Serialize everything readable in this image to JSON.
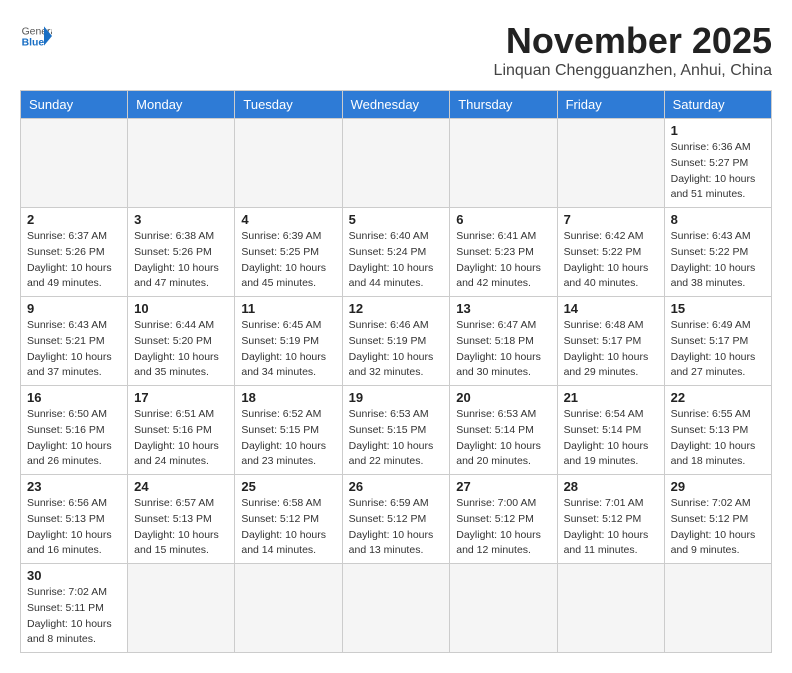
{
  "header": {
    "logo_general": "General",
    "logo_blue": "Blue",
    "month_title": "November 2025",
    "location": "Linquan Chengguanzhen, Anhui, China"
  },
  "weekdays": [
    "Sunday",
    "Monday",
    "Tuesday",
    "Wednesday",
    "Thursday",
    "Friday",
    "Saturday"
  ],
  "weeks": [
    [
      {
        "day": "",
        "empty": true
      },
      {
        "day": "",
        "empty": true
      },
      {
        "day": "",
        "empty": true
      },
      {
        "day": "",
        "empty": true
      },
      {
        "day": "",
        "empty": true
      },
      {
        "day": "",
        "empty": true
      },
      {
        "day": "1",
        "sunrise": "Sunrise: 6:36 AM",
        "sunset": "Sunset: 5:27 PM",
        "daylight": "Daylight: 10 hours and 51 minutes."
      }
    ],
    [
      {
        "day": "2",
        "sunrise": "Sunrise: 6:37 AM",
        "sunset": "Sunset: 5:26 PM",
        "daylight": "Daylight: 10 hours and 49 minutes."
      },
      {
        "day": "3",
        "sunrise": "Sunrise: 6:38 AM",
        "sunset": "Sunset: 5:26 PM",
        "daylight": "Daylight: 10 hours and 47 minutes."
      },
      {
        "day": "4",
        "sunrise": "Sunrise: 6:39 AM",
        "sunset": "Sunset: 5:25 PM",
        "daylight": "Daylight: 10 hours and 45 minutes."
      },
      {
        "day": "5",
        "sunrise": "Sunrise: 6:40 AM",
        "sunset": "Sunset: 5:24 PM",
        "daylight": "Daylight: 10 hours and 44 minutes."
      },
      {
        "day": "6",
        "sunrise": "Sunrise: 6:41 AM",
        "sunset": "Sunset: 5:23 PM",
        "daylight": "Daylight: 10 hours and 42 minutes."
      },
      {
        "day": "7",
        "sunrise": "Sunrise: 6:42 AM",
        "sunset": "Sunset: 5:22 PM",
        "daylight": "Daylight: 10 hours and 40 minutes."
      },
      {
        "day": "8",
        "sunrise": "Sunrise: 6:43 AM",
        "sunset": "Sunset: 5:22 PM",
        "daylight": "Daylight: 10 hours and 38 minutes."
      }
    ],
    [
      {
        "day": "9",
        "sunrise": "Sunrise: 6:43 AM",
        "sunset": "Sunset: 5:21 PM",
        "daylight": "Daylight: 10 hours and 37 minutes."
      },
      {
        "day": "10",
        "sunrise": "Sunrise: 6:44 AM",
        "sunset": "Sunset: 5:20 PM",
        "daylight": "Daylight: 10 hours and 35 minutes."
      },
      {
        "day": "11",
        "sunrise": "Sunrise: 6:45 AM",
        "sunset": "Sunset: 5:19 PM",
        "daylight": "Daylight: 10 hours and 34 minutes."
      },
      {
        "day": "12",
        "sunrise": "Sunrise: 6:46 AM",
        "sunset": "Sunset: 5:19 PM",
        "daylight": "Daylight: 10 hours and 32 minutes."
      },
      {
        "day": "13",
        "sunrise": "Sunrise: 6:47 AM",
        "sunset": "Sunset: 5:18 PM",
        "daylight": "Daylight: 10 hours and 30 minutes."
      },
      {
        "day": "14",
        "sunrise": "Sunrise: 6:48 AM",
        "sunset": "Sunset: 5:17 PM",
        "daylight": "Daylight: 10 hours and 29 minutes."
      },
      {
        "day": "15",
        "sunrise": "Sunrise: 6:49 AM",
        "sunset": "Sunset: 5:17 PM",
        "daylight": "Daylight: 10 hours and 27 minutes."
      }
    ],
    [
      {
        "day": "16",
        "sunrise": "Sunrise: 6:50 AM",
        "sunset": "Sunset: 5:16 PM",
        "daylight": "Daylight: 10 hours and 26 minutes."
      },
      {
        "day": "17",
        "sunrise": "Sunrise: 6:51 AM",
        "sunset": "Sunset: 5:16 PM",
        "daylight": "Daylight: 10 hours and 24 minutes."
      },
      {
        "day": "18",
        "sunrise": "Sunrise: 6:52 AM",
        "sunset": "Sunset: 5:15 PM",
        "daylight": "Daylight: 10 hours and 23 minutes."
      },
      {
        "day": "19",
        "sunrise": "Sunrise: 6:53 AM",
        "sunset": "Sunset: 5:15 PM",
        "daylight": "Daylight: 10 hours and 22 minutes."
      },
      {
        "day": "20",
        "sunrise": "Sunrise: 6:53 AM",
        "sunset": "Sunset: 5:14 PM",
        "daylight": "Daylight: 10 hours and 20 minutes."
      },
      {
        "day": "21",
        "sunrise": "Sunrise: 6:54 AM",
        "sunset": "Sunset: 5:14 PM",
        "daylight": "Daylight: 10 hours and 19 minutes."
      },
      {
        "day": "22",
        "sunrise": "Sunrise: 6:55 AM",
        "sunset": "Sunset: 5:13 PM",
        "daylight": "Daylight: 10 hours and 18 minutes."
      }
    ],
    [
      {
        "day": "23",
        "sunrise": "Sunrise: 6:56 AM",
        "sunset": "Sunset: 5:13 PM",
        "daylight": "Daylight: 10 hours and 16 minutes."
      },
      {
        "day": "24",
        "sunrise": "Sunrise: 6:57 AM",
        "sunset": "Sunset: 5:13 PM",
        "daylight": "Daylight: 10 hours and 15 minutes."
      },
      {
        "day": "25",
        "sunrise": "Sunrise: 6:58 AM",
        "sunset": "Sunset: 5:12 PM",
        "daylight": "Daylight: 10 hours and 14 minutes."
      },
      {
        "day": "26",
        "sunrise": "Sunrise: 6:59 AM",
        "sunset": "Sunset: 5:12 PM",
        "daylight": "Daylight: 10 hours and 13 minutes."
      },
      {
        "day": "27",
        "sunrise": "Sunrise: 7:00 AM",
        "sunset": "Sunset: 5:12 PM",
        "daylight": "Daylight: 10 hours and 12 minutes."
      },
      {
        "day": "28",
        "sunrise": "Sunrise: 7:01 AM",
        "sunset": "Sunset: 5:12 PM",
        "daylight": "Daylight: 10 hours and 11 minutes."
      },
      {
        "day": "29",
        "sunrise": "Sunrise: 7:02 AM",
        "sunset": "Sunset: 5:12 PM",
        "daylight": "Daylight: 10 hours and 9 minutes."
      }
    ],
    [
      {
        "day": "30",
        "sunrise": "Sunrise: 7:02 AM",
        "sunset": "Sunset: 5:11 PM",
        "daylight": "Daylight: 10 hours and 8 minutes."
      },
      {
        "day": "",
        "empty": true
      },
      {
        "day": "",
        "empty": true
      },
      {
        "day": "",
        "empty": true
      },
      {
        "day": "",
        "empty": true
      },
      {
        "day": "",
        "empty": true
      },
      {
        "day": "",
        "empty": true
      }
    ]
  ]
}
